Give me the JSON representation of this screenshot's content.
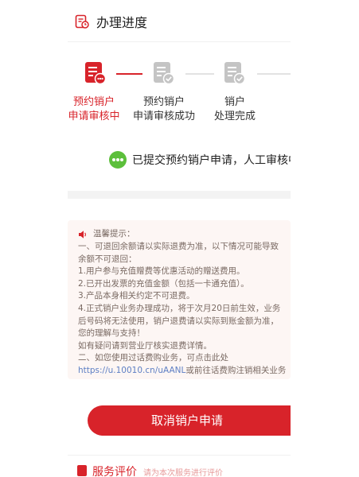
{
  "header": {
    "title": "办理进度"
  },
  "steps": [
    {
      "line1": "预约销户",
      "line2": "申请审核中",
      "state": "active"
    },
    {
      "line1": "预约销户",
      "line2": "申请审核成功",
      "state": "inactive"
    },
    {
      "line1": "销户",
      "line2": "处理完成",
      "state": "inactive"
    }
  ],
  "status": {
    "text": "已提交预约销户申请，人工审核中"
  },
  "notice": {
    "title": "温馨提示：",
    "lines": [
      "一、可退回余额请以实际退费为准，以下情况可能导致",
      "余额不可退回：",
      "1.用户参与充值赠费等优惠活动的赠送费用。",
      "2.已开出发票的充值金额（包括一卡通充值）。",
      "3.产品本身相关约定不可退费。",
      "4.正式销户业务办理成功，将于次月20日前生效，业务",
      "后号码将无法使用，销户退费请以实际到账金额为准，",
      "您的理解与支持！",
      "如有疑问请到营业厅核实退费详情。",
      "二、如您使用过话费购业务，可点击此处"
    ],
    "link": "https://u.10010.cn/uAANL",
    "link_suffix": "或前往话费购注销相关业务"
  },
  "cancel_button": {
    "label": "取消销户申请"
  },
  "rating": {
    "title": "服务评价",
    "hint": "请为本次服务进行评价"
  },
  "colors": {
    "accent": "#d8232a",
    "success": "#5cbf3b",
    "inactive_icon": "#c4c4c4",
    "link": "#5d7fc4"
  }
}
